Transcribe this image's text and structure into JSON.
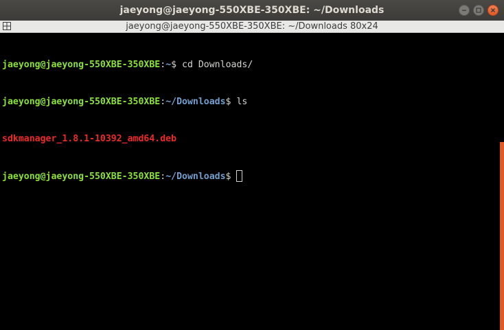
{
  "window": {
    "title": "jaeyong@jaeyong-550XBE-350XBE: ~/Downloads"
  },
  "tab": {
    "label": "jaeyong@jaeyong-550XBE-350XBE: ~/Downloads 80x24"
  },
  "terminal": {
    "lines": [
      {
        "user": "jaeyong@jaeyong-550XBE-350XBE",
        "sep": ":",
        "path": "~",
        "prompt_end": "$ ",
        "command": "cd Downloads/"
      },
      {
        "user": "jaeyong@jaeyong-550XBE-350XBE",
        "sep": ":",
        "path": "~/Downloads",
        "prompt_end": "$ ",
        "command": "ls"
      },
      {
        "output": "sdkmanager_1.8.1-10392_amd64.deb"
      },
      {
        "user": "jaeyong@jaeyong-550XBE-350XBE",
        "sep": ":",
        "path": "~/Downloads",
        "prompt_end": "$ ",
        "command": ""
      }
    ]
  },
  "colors": {
    "user": "#8ae234",
    "path": "#729fcf",
    "deb_file": "#ef2929",
    "text": "#d3d7cf",
    "background": "#000000",
    "accent": "#e05a25"
  },
  "icons": {
    "minimize": "minimize-icon",
    "maximize": "maximize-icon",
    "close": "close-icon",
    "tab": "terminal-tab-icon"
  }
}
